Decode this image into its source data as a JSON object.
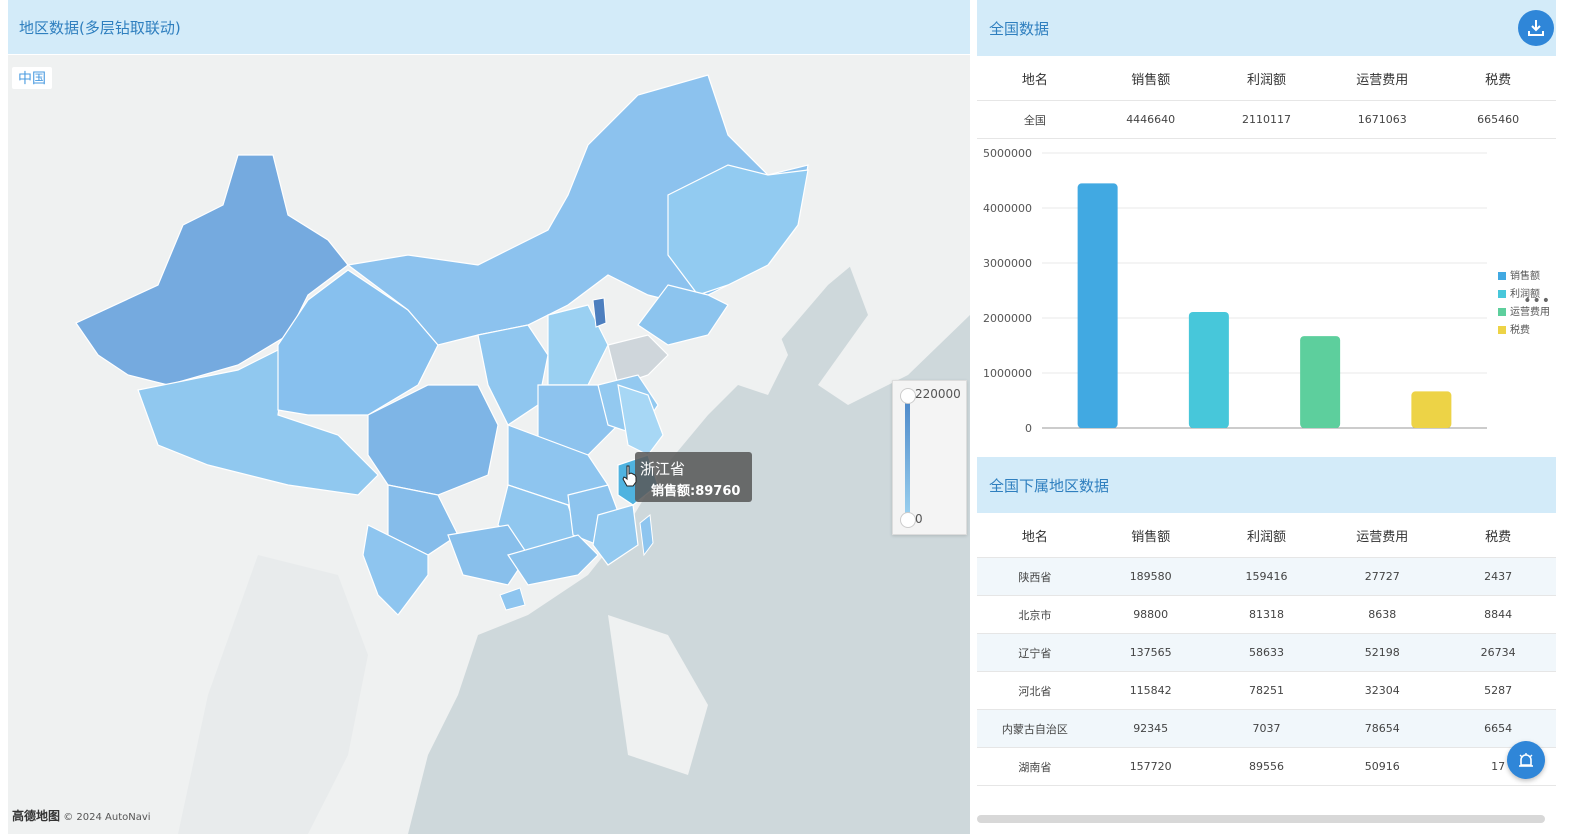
{
  "left_panel": {
    "title": "地区数据(多层钻取联动)",
    "breadcrumb": "中国",
    "legend": {
      "max": "220000",
      "min": "0"
    },
    "tooltip": {
      "region": "浙江省",
      "metric_label": "销售额",
      "value": "89760"
    },
    "attribution": {
      "brand": "高德地图",
      "copyright": "© 2024 AutoNavi"
    }
  },
  "national": {
    "title": "全国数据",
    "columns": [
      "地名",
      "销售额",
      "利润额",
      "运营费用",
      "税费"
    ],
    "row": [
      "全国",
      "4446640",
      "2110117",
      "1671063",
      "665460"
    ]
  },
  "chart_data": {
    "type": "bar",
    "categories": [
      "销售额",
      "利润额",
      "运营费用",
      "税费"
    ],
    "series": [
      {
        "name": "销售额",
        "value": 4446640,
        "color": "#41a9e2"
      },
      {
        "name": "利润额",
        "value": 2110117,
        "color": "#47c7da"
      },
      {
        "name": "运营费用",
        "value": 1671063,
        "color": "#5dcf9d"
      },
      {
        "name": "税费",
        "value": 665460,
        "color": "#edd346"
      }
    ],
    "yticks": [
      "0",
      "1000000",
      "2000000",
      "3000000",
      "4000000",
      "5000000"
    ],
    "ylim": [
      0,
      5000000
    ],
    "legend_position": "right"
  },
  "regions": {
    "title": "全国下属地区数据",
    "columns": [
      "地名",
      "销售额",
      "利润额",
      "运营费用",
      "税费"
    ],
    "rows": [
      [
        "陕西省",
        "189580",
        "159416",
        "27727",
        "2437"
      ],
      [
        "北京市",
        "98800",
        "81318",
        "8638",
        "8844"
      ],
      [
        "辽宁省",
        "137565",
        "58633",
        "52198",
        "26734"
      ],
      [
        "河北省",
        "115842",
        "78251",
        "32304",
        "5287"
      ],
      [
        "内蒙古自治区",
        "92345",
        "7037",
        "78654",
        "6654"
      ],
      [
        "湖南省",
        "157720",
        "89556",
        "50916",
        "17"
      ]
    ]
  },
  "colors": {
    "accent": "#2f86d8",
    "header_bg": "#d3ebf9",
    "header_text": "#2f7fbf"
  },
  "icons": {
    "download": "download-icon",
    "alarm": "alarm-icon",
    "more": "more-icon"
  }
}
